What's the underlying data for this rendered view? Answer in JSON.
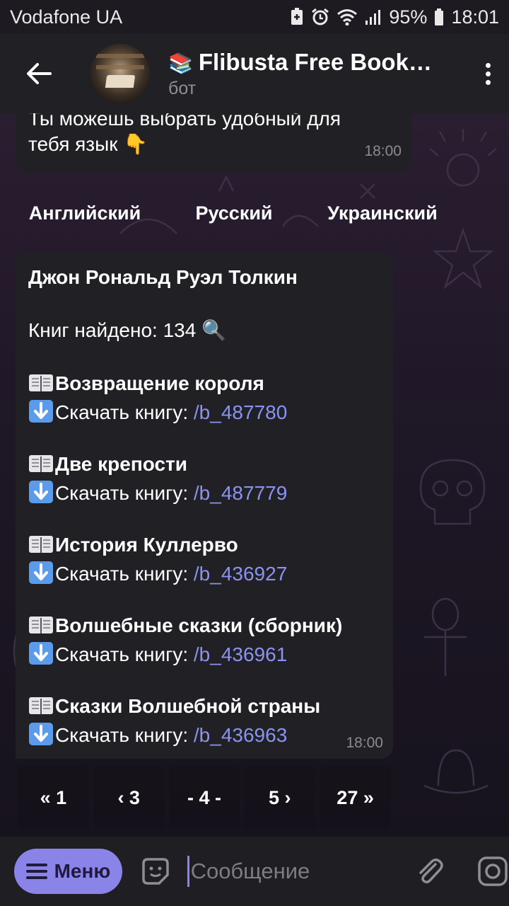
{
  "status_bar": {
    "carrier": "Vodafone UA",
    "battery": "95%",
    "time": "18:01"
  },
  "header": {
    "title_emoji": "📚",
    "title": "Flibusta Free Book…",
    "subtitle": "бот"
  },
  "messages": {
    "first": {
      "text_line1": "Ты можешь выбрать удобный для",
      "text_line2": "тебя язык 👇",
      "time": "18:00"
    },
    "language_buttons": [
      "Английский",
      "Русский",
      "Украинский"
    ],
    "results": {
      "author": "Джон Рональд Руэл Толкин",
      "found_label": "Книг найдено: 134 🔍",
      "download_label": "Скачать книгу: ",
      "books": [
        {
          "title": "Возвращение короля",
          "link": "/b_487780"
        },
        {
          "title": "Две крепости",
          "link": "/b_487779"
        },
        {
          "title": "История Куллерво",
          "link": "/b_436927"
        },
        {
          "title": "Волшебные сказки (сборник)",
          "link": "/b_436961"
        },
        {
          "title": "Сказки Волшебной страны",
          "link": "/b_436963"
        }
      ],
      "time": "18:00"
    },
    "pagination": [
      "« 1",
      "‹ 3",
      "- 4 -",
      "5 ›",
      "27 »"
    ]
  },
  "input_bar": {
    "menu_label": "Меню",
    "placeholder": "Сообщение"
  },
  "colors": {
    "accent": "#8b84e8",
    "link": "#8b93f0",
    "bubble": "#212024",
    "header": "#212024"
  }
}
